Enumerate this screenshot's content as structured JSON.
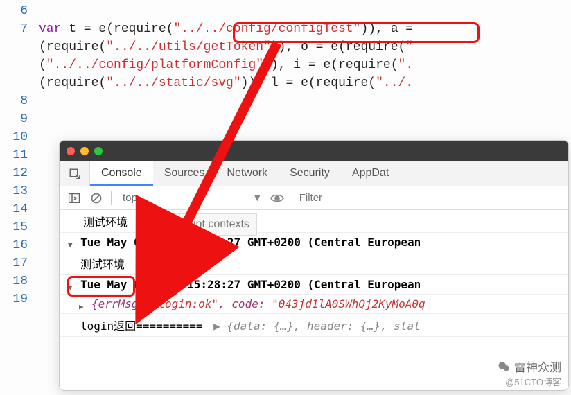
{
  "editor": {
    "lines": {
      "6": "",
      "7_pre": "var",
      "7_1a": " t = e(require(",
      "7_s1": "\"../../config/configTest\"",
      "7_1b": ")), a =",
      "7w1a": "(require(",
      "7w1s": "\"../../utils/getToken\"",
      "7w1b": ")), o = e(require(",
      "7w1c": "\"",
      "7w2a": "(",
      "7w2s": "\"../../config/platformConfig\"",
      "7w2b": ")), i = e(require(",
      "7w2c": "\".",
      "7w3a": "(require(",
      "7w3s": "\"../../static/svg\"",
      "7w3b": ")), l = e(require(",
      "7w3c": "\"../.",
      "8": "",
      "9": "",
      "10": "",
      "11": "",
      "12": "",
      "13": "",
      "14": "",
      "15": "",
      "16": "",
      "17": "",
      "18": "",
      "19": ""
    }
  },
  "devtools": {
    "tabs": {
      "console": "Console",
      "sources": "Sources",
      "network": "Network",
      "security": "Security",
      "appdata": "AppDat"
    },
    "toolbar": {
      "context": "top",
      "filter_placeholder": "Filter",
      "context_current": "测试环境"
    },
    "tooltip": "Script contexts",
    "rows": {
      "r1": "Tue May 05 2020 15:28:27 GMT+0200 (Central European",
      "r2": "测试环境",
      "r3": "Tue May 05 2020 15:28:27 GMT+0200 (Central European",
      "r4_a": "{errMsg: ",
      "r4_b": "\"login:ok\"",
      "r4_c": ", code: ",
      "r4_d": "\"043jd1lA0SWhQj2KyMoA0q",
      "r5_a": "login返回==========",
      "r5_b": "{data: {…}, header: {…}, stat"
    }
  },
  "watermark": {
    "line1": "雷神众测",
    "line2": "@51CTO博客"
  }
}
